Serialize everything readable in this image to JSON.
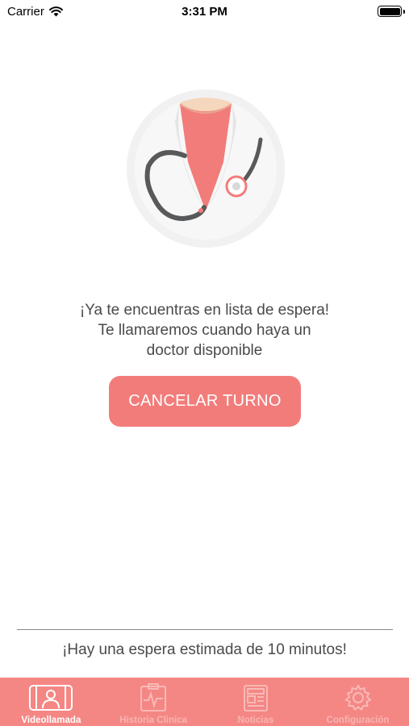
{
  "status_bar": {
    "carrier": "Carrier",
    "time": "3:31 PM",
    "battery_level": 1.0
  },
  "illustration": {
    "icon": "doctor-illustration-icon"
  },
  "message": {
    "line1": "¡Ya te encuentras en lista de espera!",
    "line2": "Te llamaremos cuando haya un",
    "line3": "doctor disponible"
  },
  "cancel_button": {
    "label": "CANCELAR TURNO"
  },
  "wait_info": {
    "text": "¡Hay una espera estimada de 10 minutos!"
  },
  "tab_bar": {
    "tabs": [
      {
        "label": "Videollamada",
        "icon": "video-call-icon",
        "active": true
      },
      {
        "label": "Historia Clinica",
        "icon": "clinical-history-icon",
        "active": false
      },
      {
        "label": "Noticias",
        "icon": "news-icon",
        "active": false
      },
      {
        "label": "Configuración",
        "icon": "gear-icon",
        "active": false
      }
    ]
  },
  "colors": {
    "accent": "#f27c7a",
    "tab_bar": "#f48784",
    "text": "#4a4a4a"
  }
}
